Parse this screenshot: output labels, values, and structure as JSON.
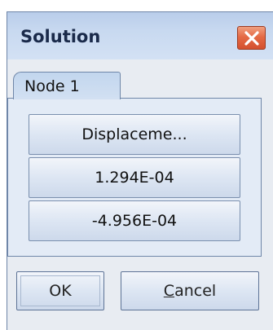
{
  "window": {
    "title": "Solution"
  },
  "tabs": [
    {
      "label": "Node 1",
      "selected": true
    }
  ],
  "cells": [
    {
      "text": "Displaceme..."
    },
    {
      "text": "1.294E-04"
    },
    {
      "text": "-4.956E-04"
    }
  ],
  "buttons": {
    "ok_label": "OK",
    "cancel_mnemonic": "C",
    "cancel_rest": "ancel"
  },
  "icons": {
    "close": "close-x-icon"
  },
  "colors": {
    "close_button": "#e56a45",
    "titlebar": "#c8d9f0",
    "panel_background": "#e3ebf6",
    "border": "#6f86a8"
  }
}
